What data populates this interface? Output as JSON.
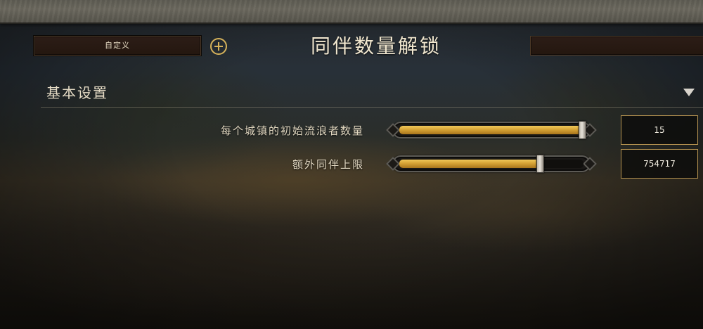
{
  "header": {
    "preset_label": "自定义",
    "title": "同伴数量解锁"
  },
  "section": {
    "title": "基本设置"
  },
  "settings": [
    {
      "label": "每个城镇的初始流浪者数量",
      "value": "15",
      "slider_fraction": 1.0
    },
    {
      "label": "额外同伴上限",
      "value": "754717",
      "slider_fraction": 0.77
    }
  ],
  "icons": {
    "add": "plus-circle-icon",
    "collapse": "triangle-down-icon"
  },
  "colors": {
    "accent_gold": "#d6b25a",
    "slider_fill": "#d6a335",
    "text": "#e6dcc6"
  }
}
